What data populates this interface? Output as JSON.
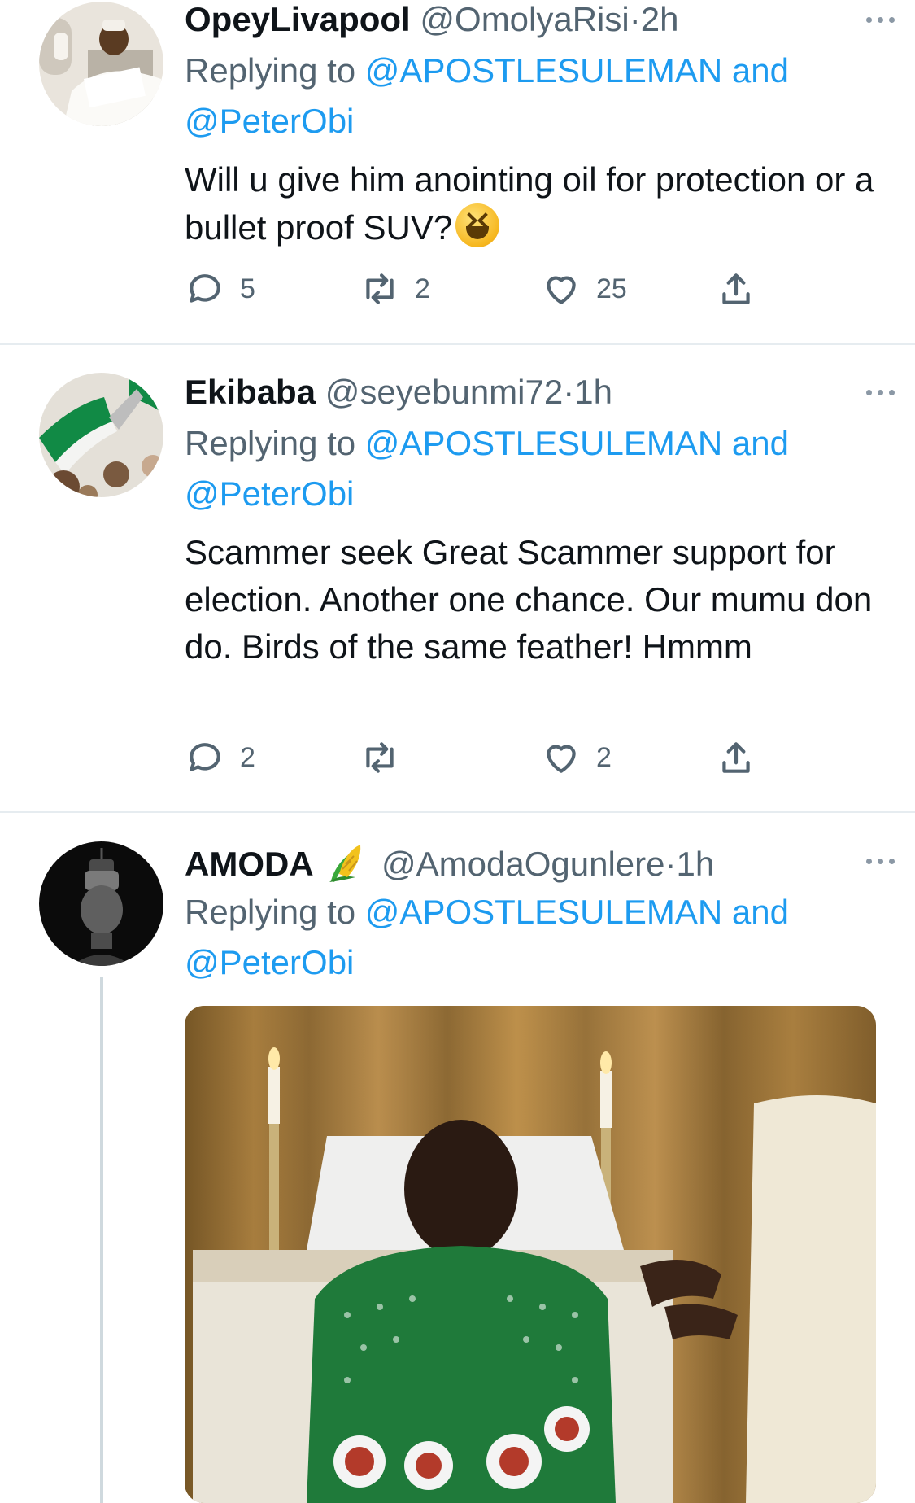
{
  "tweets": [
    {
      "name": "OpeyLivapool",
      "handle": "@OmolyaRisi",
      "dot": "·",
      "time": "2h",
      "reply_prefix": "Replying to ",
      "mention1": "@APOSTLESULEMAN",
      "and": " and",
      "mention2": "@PeterObi",
      "text": "Will u give him anointing oil for protection or a bullet proof SUV?",
      "emoji": "laughing-face",
      "replies": "5",
      "retweets": "2",
      "likes": "25"
    },
    {
      "name": "Ekibaba",
      "handle": "@seyebunmi72",
      "dot": "·",
      "time": "1h",
      "reply_prefix": "Replying to ",
      "mention1": "@APOSTLESULEMAN",
      "and": " and",
      "mention2": "@PeterObi",
      "text": "Scammer seek Great Scammer support for election. Another one chance. Our mumu don do. Birds of the same feather! Hmmm",
      "replies": "2",
      "retweets": "",
      "likes": "2"
    },
    {
      "name": "AMODA",
      "name_emoji": "corn",
      "handle": "@AmodaOgunlere",
      "dot": "·",
      "time": "1h",
      "reply_prefix": "Replying to ",
      "mention1": "@APOSTLESULEMAN",
      "and": " and",
      "mention2": "@PeterObi",
      "media": "photo"
    }
  ],
  "colors": {
    "accent": "#1d9bf0",
    "muted": "#536471",
    "divider": "#e6ecf0"
  }
}
